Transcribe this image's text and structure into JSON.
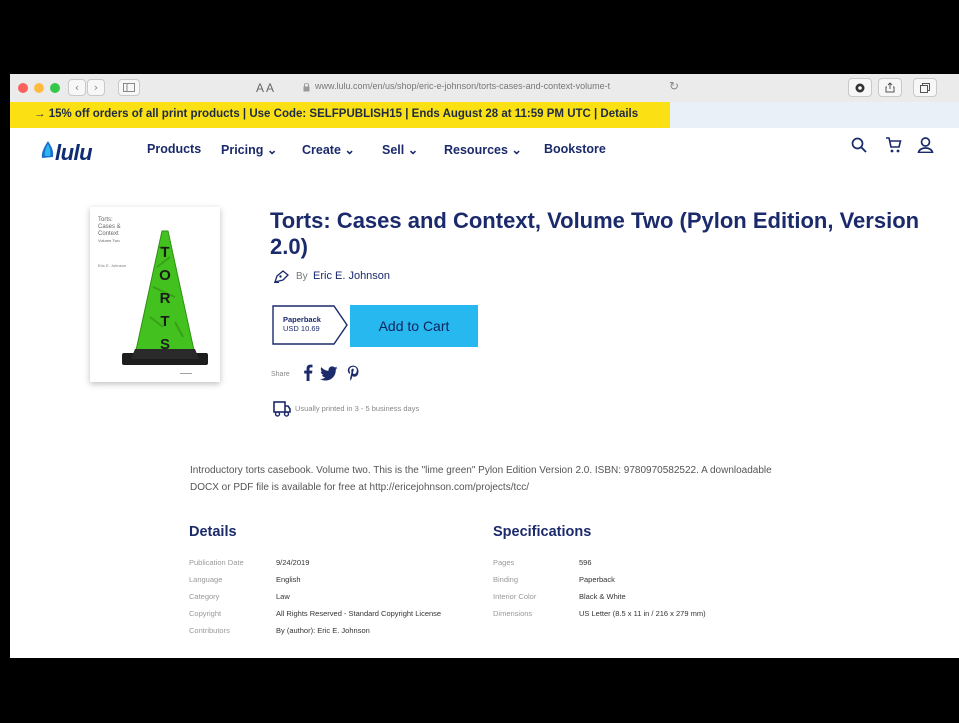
{
  "browser": {
    "text_size": "A A",
    "url": "www.lulu.com/en/us/shop/eric-e-johnson/torts-cases-and-context-volume-t"
  },
  "promo": {
    "text": "→ 15% off orders of all print products | Use Code: SELFPUBLISH15 | Ends August 28 at 11:59 PM UTC | Details"
  },
  "nav": {
    "logo": "lulu",
    "items": [
      {
        "label": "Products"
      },
      {
        "label": "Pricing ⌄"
      },
      {
        "label": "Create ⌄"
      },
      {
        "label": "Sell ⌄"
      },
      {
        "label": "Resources ⌄"
      },
      {
        "label": "Bookstore"
      }
    ],
    "icons": [
      "search-icon",
      "cart-icon",
      "account-icon"
    ]
  },
  "cover": {
    "title_lines": [
      "Torts:",
      "Cases &",
      "Context"
    ],
    "subtitle": "Volume Two",
    "author": "Eric E. Johnson",
    "word": "TORTS",
    "accent": "#43c21f"
  },
  "product": {
    "title": "Torts: Cases and Context, Volume Two (Pylon Edition, Version 2.0)",
    "by": "By",
    "author": "Eric E. Johnson",
    "format": "Paperback",
    "price": "USD 10.69",
    "add_to_cart": "Add to Cart",
    "share_label": "Share",
    "shipping": "Usually printed in 3 - 5 business days"
  },
  "description": "Introductory torts casebook. Volume two. This is the \"lime green\" Pylon Edition Version 2.0. ISBN: 9780970582522. A downloadable DOCX or PDF file is available for free at http://ericejohnson.com/projects/tcc/",
  "details": {
    "heading": "Details",
    "rows": [
      {
        "key": "Publication Date",
        "value": "9/24/2019"
      },
      {
        "key": "Language",
        "value": "English"
      },
      {
        "key": "Category",
        "value": "Law"
      },
      {
        "key": "Copyright",
        "value": "All Rights Reserved - Standard Copyright License"
      },
      {
        "key": "Contributors",
        "value": "By (author): Eric E. Johnson"
      }
    ]
  },
  "specifications": {
    "heading": "Specifications",
    "rows": [
      {
        "key": "Pages",
        "value": "596"
      },
      {
        "key": "Binding",
        "value": "Paperback"
      },
      {
        "key": "Interior Color",
        "value": "Black & White"
      },
      {
        "key": "Dimensions",
        "value": "US Letter (8.5 x 11 in / 216 x 279 mm)"
      }
    ]
  },
  "colors": {
    "brand": "#1b2a6b",
    "cta": "#27b8f0",
    "promo": "#fbe114"
  }
}
